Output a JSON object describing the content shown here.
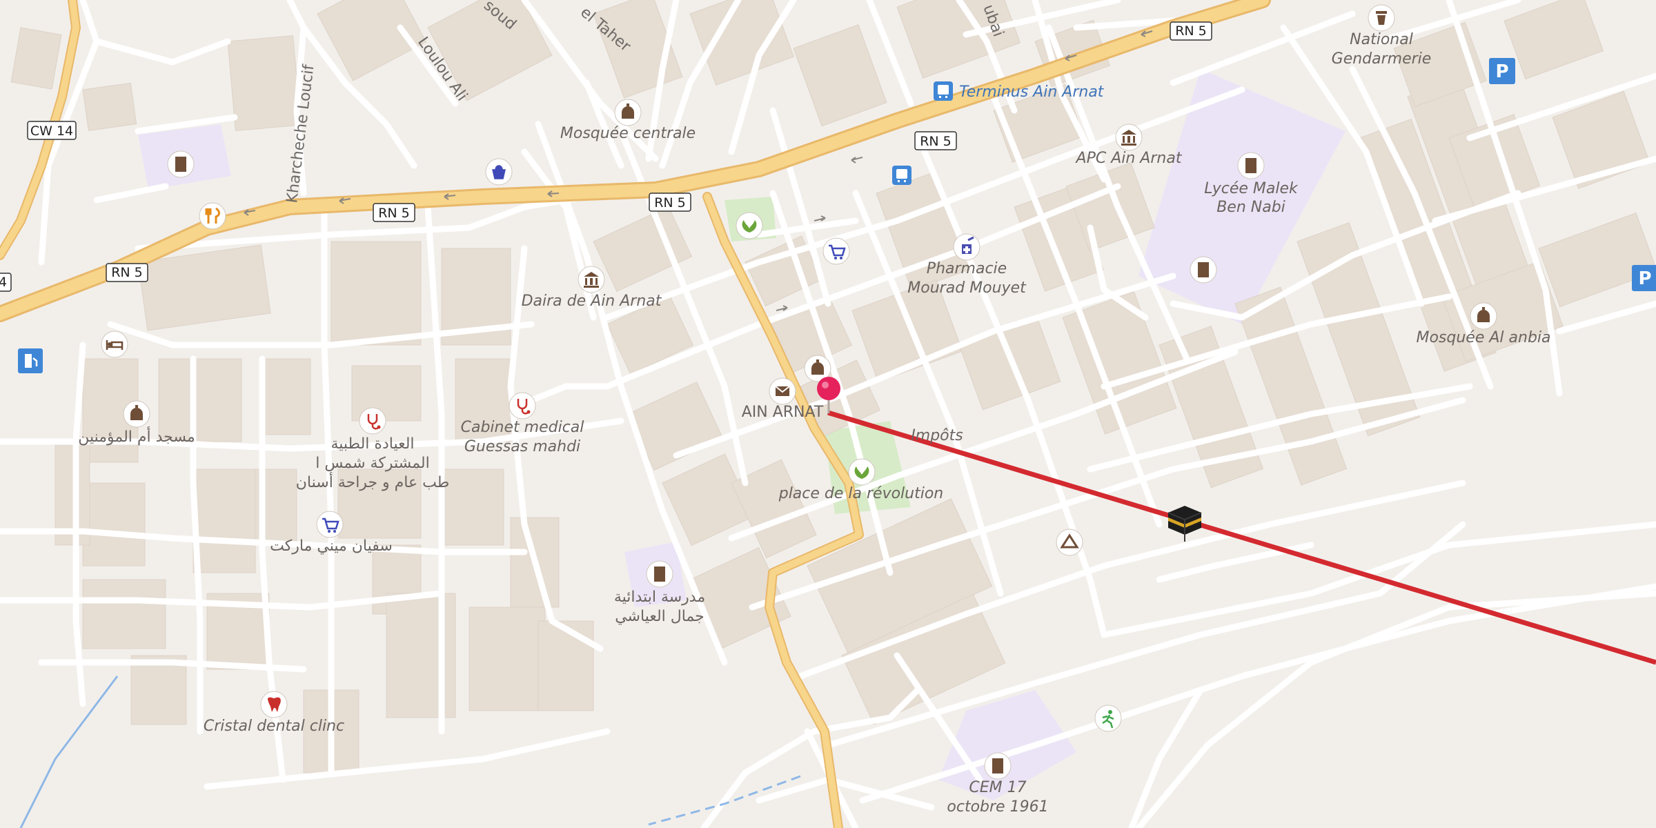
{
  "map": {
    "colors": {
      "background": "#f2efeb",
      "block": "#ece5dd",
      "building": "#e3d9cf",
      "road_minor": "#ffffff",
      "road_major": "#f7d58a",
      "road_major_outline": "#e8b86a",
      "route_line": "#d32a30",
      "poi_brown": "#6f4e37",
      "poi_blue": "#3f74b8",
      "poi_green": "#6aa53a",
      "park": "#d7ebc8",
      "school": "#ebe4f6",
      "water": "#8fb8e6"
    },
    "road_shields": [
      {
        "id": "cw14",
        "text": "CW 14"
      },
      {
        "id": "rn5_a",
        "text": "RN 5"
      },
      {
        "id": "rn5_b",
        "text": "RN 5"
      },
      {
        "id": "rn5_c",
        "text": "RN 5"
      },
      {
        "id": "rn5_d",
        "text": "RN 5"
      },
      {
        "id": "rn5_e",
        "text": "RN 5"
      },
      {
        "id": "edge",
        "text": "4"
      }
    ],
    "street_names": {
      "loulou_ali": "Loulou Ali",
      "kharcheche": "Kharcheche Loucif",
      "soud": "soud",
      "el_taher": "el Taher",
      "ubai": "ubai"
    },
    "places": {
      "mosquee_centrale": "Mosquée centrale",
      "terminus": "Terminus Ain Arnat",
      "national_1": "National",
      "national_2": "Gendarmerie",
      "apc": "APC Ain Arnat",
      "lycee_1": "Lycée Malek",
      "lycee_2": "Ben Nabi",
      "pharmacie_1": "Pharmacie",
      "pharmacie_2": "Mourad Mouyet",
      "daira": "Daira de Ain Arnat",
      "mosquee_anbia": "Mosquée Al anbia",
      "ain_arnat": "AIN ARNAT",
      "impots": "Impôts",
      "cabinet_1": "Cabinet medical",
      "cabinet_2": "Guessas mahdi",
      "place_rev": "place de la révolution",
      "mosque_ar": "مسجد أم المؤمنين",
      "clinic_ar_1": "العيادة الطبية",
      "clinic_ar_2": "المشتركة شمس ا",
      "clinic_ar_3": "طب عام و جراحة أسنان",
      "market_ar": "سفيان ميني ماركت",
      "school_ar_1": "مدرسة ابتدائية",
      "school_ar_2": "جمال العياشي",
      "dental": "Cristal dental clinc",
      "cem_1": "CEM 17",
      "cem_2": "octobre 1961"
    },
    "icons": [
      "mosque-icon",
      "shopping-bag-icon",
      "restaurant-icon",
      "school-icon",
      "hotel-icon",
      "fuel-icon",
      "bus-stop-icon",
      "park-icon",
      "supermarket-icon",
      "pharmacy-icon",
      "town-hall-icon",
      "police-icon",
      "parking-icon",
      "post-office-icon",
      "medical-icon",
      "dental-icon",
      "viewpoint-icon",
      "sports-icon",
      "kaaba-qibla-icon",
      "location-pin-icon"
    ]
  }
}
